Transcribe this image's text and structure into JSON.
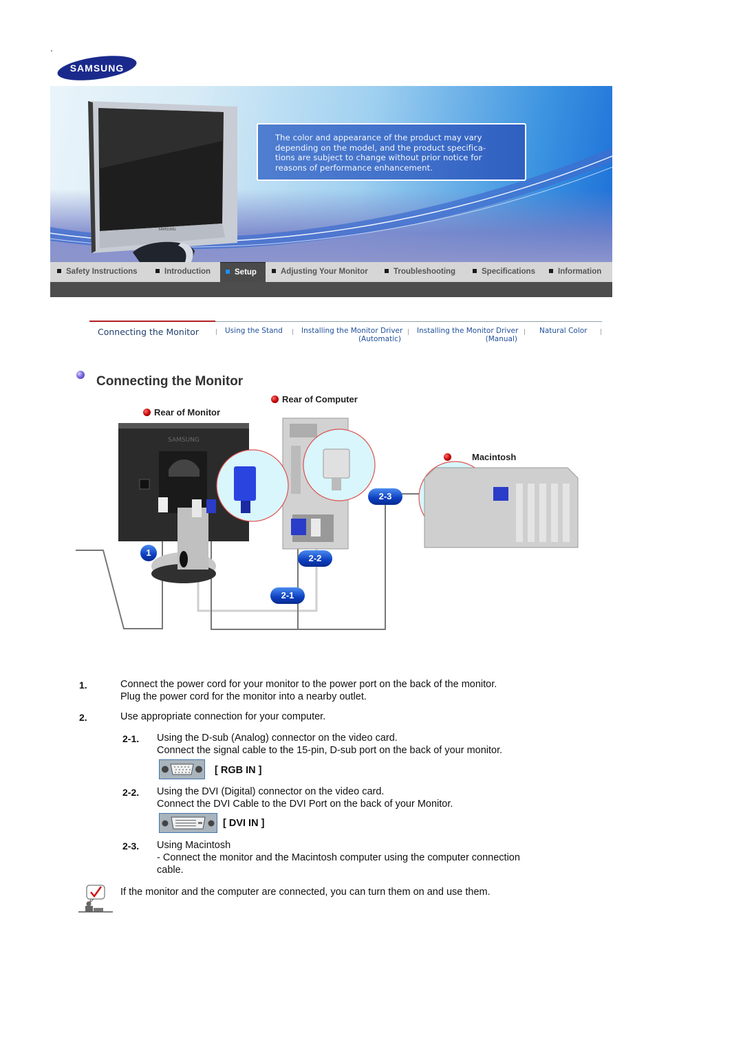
{
  "header": {
    "logo_text": "SAMSUNG",
    "banner_notice": "The color and appearance of the product may vary depending on the model, and the product specifica- tions are subject to change without prior notice for reasons of performance enhancement.",
    "banner_notice_lines": [
      "The color and appearance of the product may vary",
      "depending on the model, and the product specifica-",
      "tions are subject to change without prior notice for",
      "reasons of performance enhancement."
    ],
    "monitor_brand": "SAMSUNG"
  },
  "nav": {
    "items": [
      {
        "label": "Safety Instructions",
        "active": false
      },
      {
        "label": "Introduction",
        "active": false
      },
      {
        "label": "Setup",
        "active": true
      },
      {
        "label": "Adjusting Your Monitor",
        "active": false
      },
      {
        "label": "Troubleshooting",
        "active": false
      },
      {
        "label": "Specifications",
        "active": false
      },
      {
        "label": "Information",
        "active": false
      }
    ],
    "active_color": "#1e90ff"
  },
  "subnav": {
    "items": [
      {
        "label": "Connecting the Monitor",
        "sub": "",
        "current": true
      },
      {
        "label": "Using the Stand",
        "sub": ""
      },
      {
        "label": "Installing the Monitor Driver",
        "sub": "(Automatic)"
      },
      {
        "label": "Installing the Monitor Driver",
        "sub": "(Manual)"
      },
      {
        "label": "Natural Color",
        "sub": ""
      }
    ],
    "accent_color": "#b22222"
  },
  "section": {
    "title": "Connecting the Monitor"
  },
  "diagram": {
    "labels": {
      "rear_monitor": "Rear of Monitor",
      "rear_computer": "Rear of Computer",
      "macintosh": "Macintosh"
    },
    "badges": {
      "power": "1",
      "dsub": "2-1",
      "dvi": "2-2",
      "mac": "2-3"
    },
    "monitor_brand": "SAMSUNG"
  },
  "instructions": {
    "step1": {
      "num": "1.",
      "lines": [
        "Connect the power cord for your monitor to the power port on the back of the monitor.",
        "Plug the power cord for the monitor into a nearby outlet."
      ]
    },
    "step2": {
      "num": "2.",
      "text": "Use appropriate connection for your computer."
    },
    "step2_1": {
      "num": "2-1.",
      "lines": [
        "Using the D-sub (Analog) connector on the video card.",
        "Connect the signal cable to the 15-pin, D-sub port on the back of your monitor."
      ],
      "connector_label": "[ RGB IN ]"
    },
    "step2_2": {
      "num": "2-2.",
      "lines": [
        "Using the DVI (Digital) connector on the video card.",
        "Connect the DVI Cable to the DVI Port on the back of your Monitor."
      ],
      "connector_label": "[ DVI IN ]"
    },
    "step2_3": {
      "num": "2-3.",
      "lines": [
        "Using Macintosh",
        "- Connect the monitor and the Macintosh computer using the computer connection",
        "cable."
      ]
    },
    "note": "If the monitor and the computer are connected, you can turn them on and use them."
  }
}
